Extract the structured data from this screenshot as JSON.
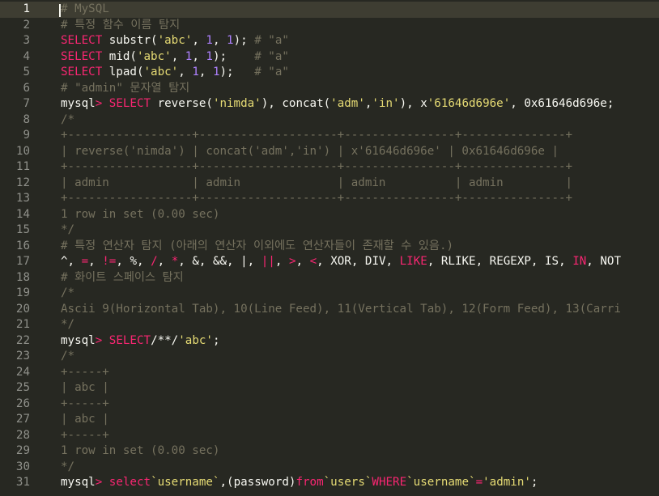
{
  "editor": {
    "current_line": 1,
    "lines": [
      {
        "n": "1",
        "tokens": [
          [
            "c-cm",
            "# MySQL"
          ]
        ]
      },
      {
        "n": "2",
        "tokens": [
          [
            "c-cm",
            "# 특정 함수 이름 탐지"
          ]
        ]
      },
      {
        "n": "3",
        "tokens": [
          [
            "c-kw",
            "SELECT"
          ],
          [
            "c-tx",
            " substr("
          ],
          [
            "c-st",
            "'abc'"
          ],
          [
            "c-tx",
            ", "
          ],
          [
            "c-nm",
            "1"
          ],
          [
            "c-tx",
            ", "
          ],
          [
            "c-nm",
            "1"
          ],
          [
            "c-tx",
            "); "
          ],
          [
            "c-cm",
            "# \"a\""
          ]
        ]
      },
      {
        "n": "4",
        "tokens": [
          [
            "c-kw",
            "SELECT"
          ],
          [
            "c-tx",
            " mid("
          ],
          [
            "c-st",
            "'abc'"
          ],
          [
            "c-tx",
            ", "
          ],
          [
            "c-nm",
            "1"
          ],
          [
            "c-tx",
            ", "
          ],
          [
            "c-nm",
            "1"
          ],
          [
            "c-tx",
            ");    "
          ],
          [
            "c-cm",
            "# \"a\""
          ]
        ]
      },
      {
        "n": "5",
        "tokens": [
          [
            "c-kw",
            "SELECT"
          ],
          [
            "c-tx",
            " lpad("
          ],
          [
            "c-st",
            "'abc'"
          ],
          [
            "c-tx",
            ", "
          ],
          [
            "c-nm",
            "1"
          ],
          [
            "c-tx",
            ", "
          ],
          [
            "c-nm",
            "1"
          ],
          [
            "c-tx",
            ");   "
          ],
          [
            "c-cm",
            "# \"a\""
          ]
        ]
      },
      {
        "n": "6",
        "tokens": [
          [
            "c-cm",
            "# \"admin\" 문자열 탐지"
          ]
        ]
      },
      {
        "n": "7",
        "tokens": [
          [
            "c-tx",
            "mysql"
          ],
          [
            "c-kw",
            "> SELECT"
          ],
          [
            "c-tx",
            " reverse("
          ],
          [
            "c-st",
            "'nimda'"
          ],
          [
            "c-tx",
            "), concat("
          ],
          [
            "c-st",
            "'adm'"
          ],
          [
            "c-tx",
            ","
          ],
          [
            "c-st",
            "'in'"
          ],
          [
            "c-tx",
            "), x"
          ],
          [
            "c-st",
            "'61646d696e'"
          ],
          [
            "c-tx",
            ", 0x61646d696e;"
          ]
        ]
      },
      {
        "n": "8",
        "tokens": [
          [
            "c-cm",
            "/*"
          ]
        ]
      },
      {
        "n": "9",
        "tokens": [
          [
            "c-cm",
            "+------------------+--------------------+----------------+---------------+"
          ]
        ]
      },
      {
        "n": "10",
        "tokens": [
          [
            "c-cm",
            "| reverse('nimda') | concat('adm','in') | x'61646d696e' | 0x61646d696e |"
          ]
        ]
      },
      {
        "n": "11",
        "tokens": [
          [
            "c-cm",
            "+------------------+--------------------+----------------+---------------+"
          ]
        ]
      },
      {
        "n": "12",
        "tokens": [
          [
            "c-cm",
            "| admin            | admin              | admin          | admin         |"
          ]
        ]
      },
      {
        "n": "13",
        "tokens": [
          [
            "c-cm",
            "+------------------+--------------------+----------------+---------------+"
          ]
        ]
      },
      {
        "n": "14",
        "tokens": [
          [
            "c-cm",
            "1 row in set (0.00 sec)"
          ]
        ]
      },
      {
        "n": "15",
        "tokens": [
          [
            "c-cm",
            "*/"
          ]
        ]
      },
      {
        "n": "16",
        "tokens": [
          [
            "c-cm",
            "# 특정 연산자 탐지 (아래의 연산자 이외에도 연산자들이 존재할 수 있음.)"
          ]
        ]
      },
      {
        "n": "17",
        "tokens": [
          [
            "c-tx",
            "^, "
          ],
          [
            "c-kw",
            "="
          ],
          [
            "c-tx",
            ", "
          ],
          [
            "c-kw",
            "!="
          ],
          [
            "c-tx",
            ", %, "
          ],
          [
            "c-kw",
            "/"
          ],
          [
            "c-tx",
            ", "
          ],
          [
            "c-kw",
            "*"
          ],
          [
            "c-tx",
            ", &, &&, |, "
          ],
          [
            "c-kw",
            "||"
          ],
          [
            "c-tx",
            ", "
          ],
          [
            "c-kw",
            ">"
          ],
          [
            "c-tx",
            ", "
          ],
          [
            "c-kw",
            "<"
          ],
          [
            "c-tx",
            ", XOR, DIV, "
          ],
          [
            "c-kw",
            "LIKE"
          ],
          [
            "c-tx",
            ", RLIKE, REGEXP, IS, "
          ],
          [
            "c-kw",
            "IN"
          ],
          [
            "c-tx",
            ", NOT"
          ]
        ]
      },
      {
        "n": "18",
        "tokens": [
          [
            "c-cm",
            "# 화이트 스페이스 탐지"
          ]
        ]
      },
      {
        "n": "19",
        "tokens": [
          [
            "c-cm",
            "/*"
          ]
        ]
      },
      {
        "n": "20",
        "tokens": [
          [
            "c-cm",
            "Ascii 9(Horizontal Tab), 10(Line Feed), 11(Vertical Tab), 12(Form Feed), 13(Carri"
          ]
        ]
      },
      {
        "n": "21",
        "tokens": [
          [
            "c-cm",
            "*/"
          ]
        ]
      },
      {
        "n": "22",
        "tokens": [
          [
            "c-tx",
            "mysql"
          ],
          [
            "c-kw",
            "> SELECT"
          ],
          [
            "c-tx",
            "/**/"
          ],
          [
            "c-st",
            "'abc'"
          ],
          [
            "c-tx",
            ";"
          ]
        ]
      },
      {
        "n": "23",
        "tokens": [
          [
            "c-cm",
            "/*"
          ]
        ]
      },
      {
        "n": "24",
        "tokens": [
          [
            "c-cm",
            "+-----+"
          ]
        ]
      },
      {
        "n": "25",
        "tokens": [
          [
            "c-cm",
            "| abc |"
          ]
        ]
      },
      {
        "n": "26",
        "tokens": [
          [
            "c-cm",
            "+-----+"
          ]
        ]
      },
      {
        "n": "27",
        "tokens": [
          [
            "c-cm",
            "| abc |"
          ]
        ]
      },
      {
        "n": "28",
        "tokens": [
          [
            "c-cm",
            "+-----+"
          ]
        ]
      },
      {
        "n": "29",
        "tokens": [
          [
            "c-cm",
            "1 row in set (0.00 sec)"
          ]
        ]
      },
      {
        "n": "30",
        "tokens": [
          [
            "c-cm",
            "*/"
          ]
        ]
      },
      {
        "n": "31",
        "tokens": [
          [
            "c-tx",
            "mysql"
          ],
          [
            "c-kw",
            "> select"
          ],
          [
            "c-st",
            "`username`"
          ],
          [
            "c-tx",
            ",(password)"
          ],
          [
            "c-kw",
            "from"
          ],
          [
            "c-st",
            "`users`"
          ],
          [
            "c-kw",
            "WHERE"
          ],
          [
            "c-st",
            "`username`"
          ],
          [
            "c-kw",
            "="
          ],
          [
            "c-st",
            "'admin'"
          ],
          [
            "c-tx",
            ";"
          ]
        ]
      }
    ]
  }
}
